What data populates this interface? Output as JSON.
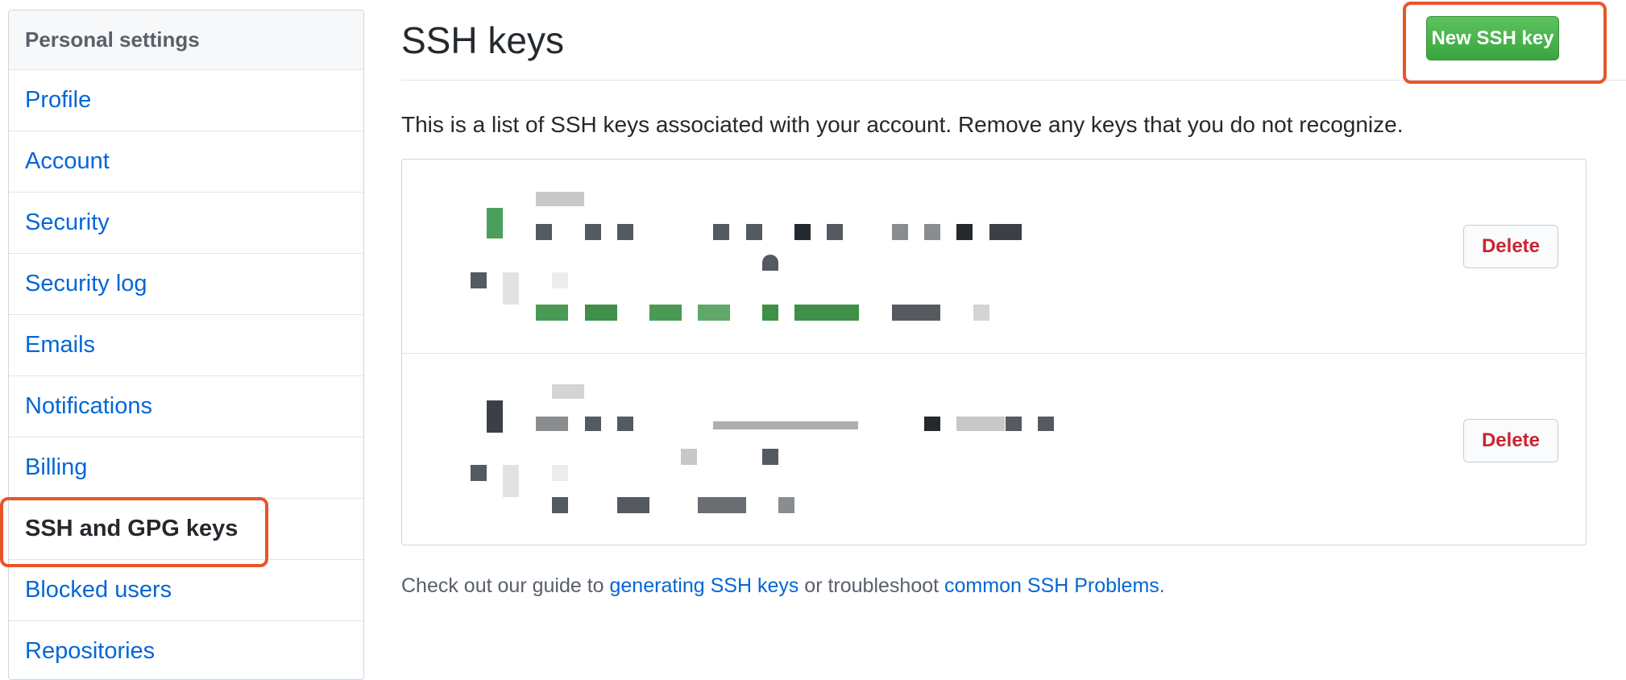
{
  "sidebar": {
    "header": "Personal settings",
    "items": [
      {
        "label": "Profile"
      },
      {
        "label": "Account"
      },
      {
        "label": "Security"
      },
      {
        "label": "Security log"
      },
      {
        "label": "Emails"
      },
      {
        "label": "Notifications"
      },
      {
        "label": "Billing"
      },
      {
        "label": "SSH and GPG keys",
        "selected": true
      },
      {
        "label": "Blocked users"
      },
      {
        "label": "Repositories"
      }
    ]
  },
  "main": {
    "title": "SSH keys",
    "new_key_label": "New SSH key",
    "intro": "This is a list of SSH keys associated with your account. Remove any keys that you do not recognize.",
    "keys": [
      {
        "delete_label": "Delete"
      },
      {
        "delete_label": "Delete"
      }
    ],
    "footer": {
      "prefix": "Check out our guide to ",
      "link1": "generating SSH keys",
      "middle": " or troubleshoot ",
      "link2": "common SSH Problems",
      "suffix": "."
    }
  },
  "colors": {
    "link": "#0366d6",
    "primary_button": "#3aa53e",
    "danger": "#cb2431",
    "annotation": "#e8552b"
  }
}
